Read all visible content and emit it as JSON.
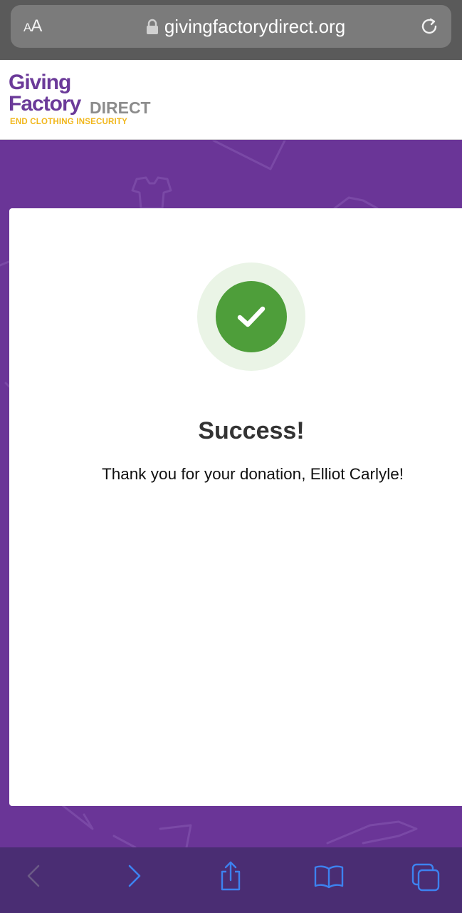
{
  "browser": {
    "aa_label_small": "A",
    "aa_label_large": "A",
    "url": "givingfactorydirect.org",
    "icons": [
      "lock-icon",
      "reload-icon",
      "back-icon",
      "forward-icon",
      "share-icon",
      "bookmarks-icon",
      "tabs-icon"
    ]
  },
  "logo": {
    "line1": "Giving",
    "line2": "Factory",
    "direct": "DIRECT",
    "tagline": "END CLOTHING INSECURITY"
  },
  "card": {
    "title": "Success!",
    "message": "Thank you for your donation, Elliot Carlyle!"
  },
  "colors": {
    "brand_purple": "#6a3597",
    "logo_purple": "#6b3a99",
    "tagline_yellow": "#f1b71c",
    "success_green": "#4e9e3a",
    "toolbar_blue": "#3d82f0"
  }
}
